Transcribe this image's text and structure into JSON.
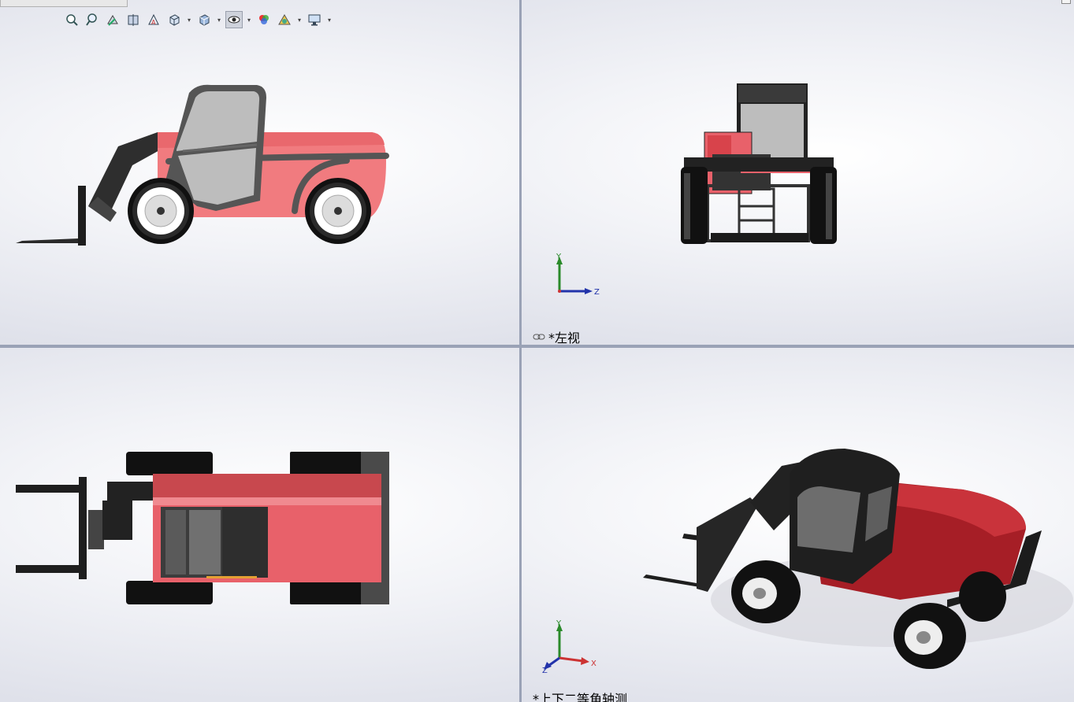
{
  "toolbar": {
    "tools": [
      {
        "icon": "zoom-to-fit-icon"
      },
      {
        "icon": "zoom-to-area-icon"
      },
      {
        "icon": "previous-view-icon"
      },
      {
        "icon": "section-view-icon"
      },
      {
        "icon": "dynamic-annotation-icon"
      },
      {
        "icon": "view-orientation-icon"
      },
      {
        "icon": "display-style-icon"
      },
      {
        "icon": "hide-show-items-icon"
      },
      {
        "icon": "edit-appearance-icon"
      },
      {
        "icon": "apply-scene-icon"
      },
      {
        "icon": "view-settings-icon"
      }
    ]
  },
  "viewports": {
    "top_right": {
      "label": "*左视",
      "axes": {
        "vertical": "Y",
        "horizontal": "Z"
      }
    },
    "bottom_right": {
      "label": "*上下二等角轴测",
      "axes": {
        "vertical": "Y",
        "horizontal": "X",
        "depth": "Z"
      }
    }
  },
  "colors": {
    "body": "#e8616a",
    "body_dark": "#b3262c",
    "tyre": "#1c1c1c",
    "cab_glass": "#bdbdbd",
    "frame": "#333333"
  }
}
